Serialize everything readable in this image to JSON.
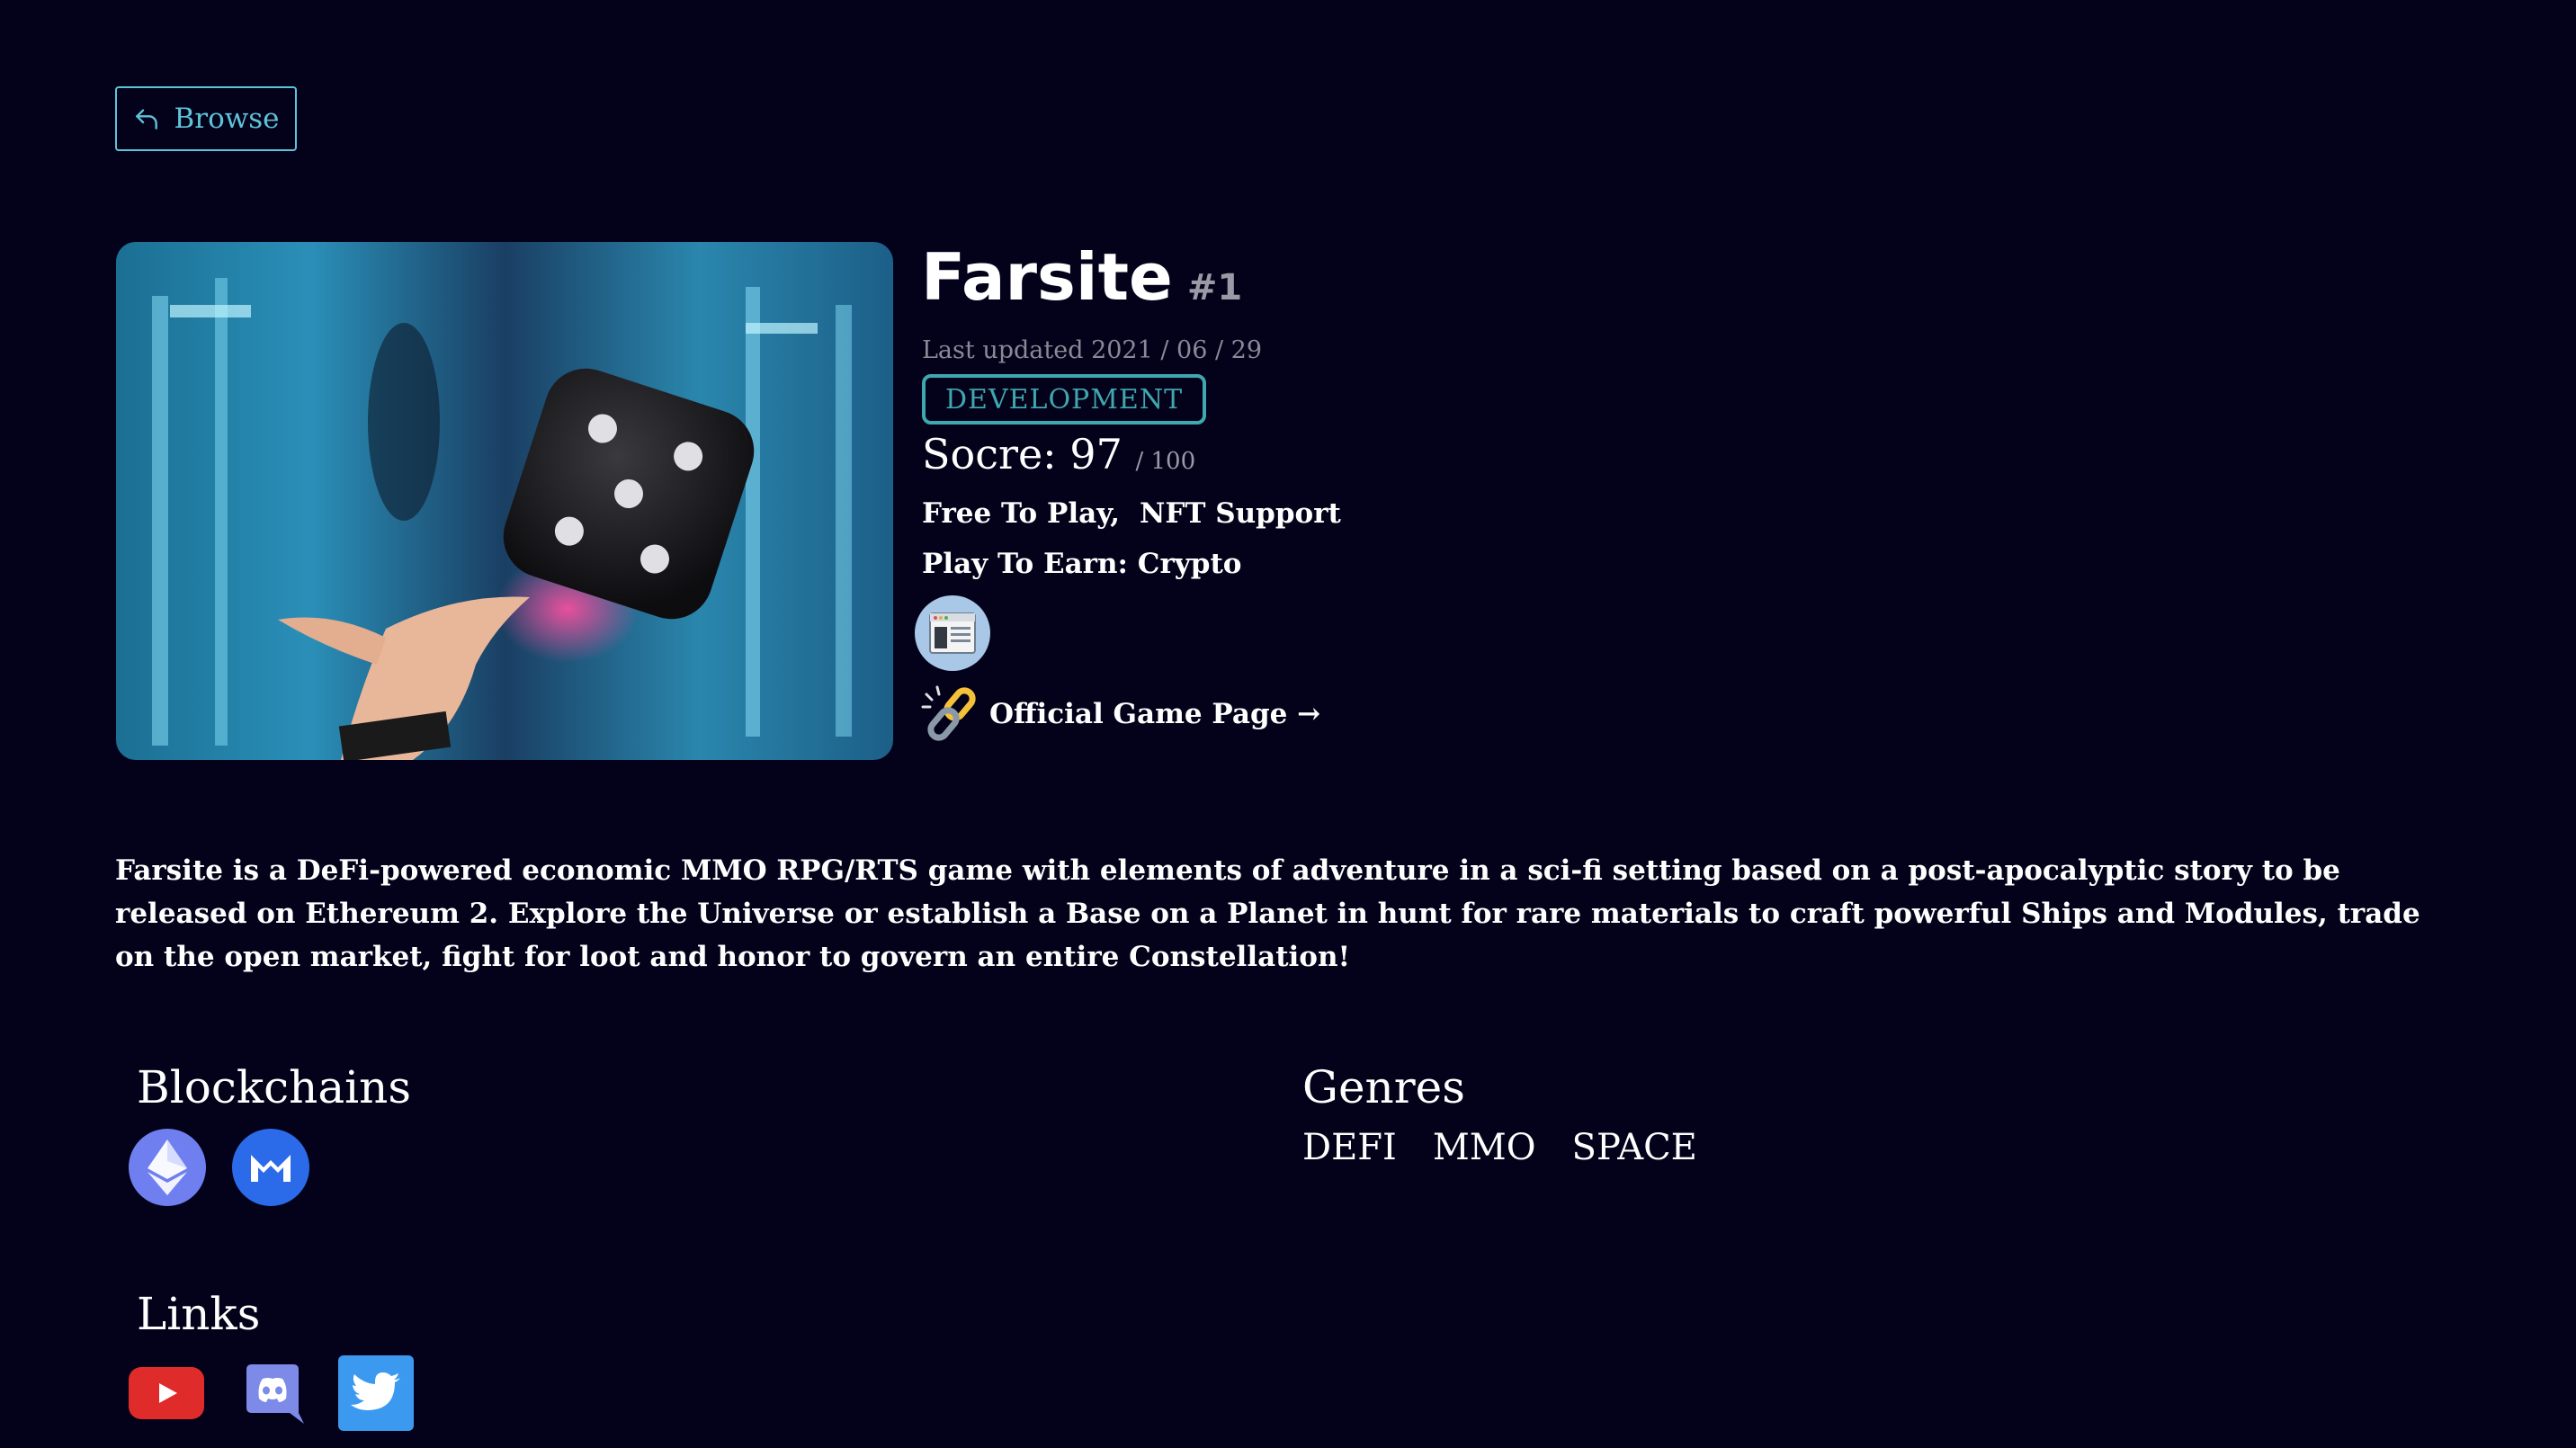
{
  "nav": {
    "browse_label": "Browse",
    "icon": "return-arrow-icon"
  },
  "game": {
    "title": "Farsite",
    "rank": "#1",
    "last_updated": "Last updated 2021 / 06 / 29",
    "status": "DEVELOPMENT",
    "score_label": "Socre: 97",
    "score_max": "/ 100",
    "features": [
      "Free To Play,",
      "NFT Support"
    ],
    "play_to_earn": "Play To Earn: Crypto",
    "official_link": "Official Game Page →",
    "description": "Farsite is a DeFi-powered economic MMO RPG/RTS game with elements of adventure in a sci-fi setting based on a post-apocalyptic story to be released on Ethereum 2. Explore the Universe or establish a Base on a Planet in hunt for rare materials to craft powerful Ships and Modules, trade on the open market, fight for loot and honor to govern an entire Constellation!"
  },
  "blockchains": {
    "title": "Blockchains",
    "icons": [
      "ethereum-icon",
      "matic-icon"
    ]
  },
  "genres": {
    "title": "Genres",
    "items": [
      "DEFI",
      "MMO",
      "SPACE"
    ]
  },
  "links": {
    "title": "Links",
    "icons": [
      "youtube-icon",
      "discord-icon",
      "twitter-icon"
    ]
  },
  "colors": {
    "background": "#04021a",
    "accent": "#5ec3d8",
    "badge": "#3fa7b0"
  }
}
